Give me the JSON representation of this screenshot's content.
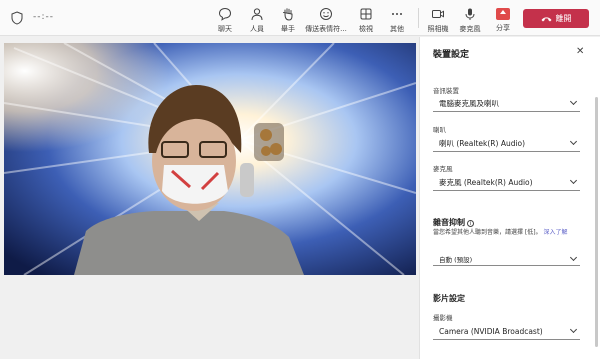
{
  "header": {
    "timer": "--:--"
  },
  "toolbar": [
    {
      "label": "聊天",
      "icon": "chat-icon"
    },
    {
      "label": "人員",
      "icon": "people-icon"
    },
    {
      "label": "舉手",
      "icon": "raise-hand-icon"
    },
    {
      "label": "傳送表情符...",
      "icon": "emoji-icon"
    },
    {
      "label": "檢視",
      "icon": "view-icon"
    },
    {
      "label": "其他",
      "icon": "more-icon"
    },
    {
      "label": "照相機",
      "icon": "camera-icon"
    },
    {
      "label": "麥克風",
      "icon": "mic-icon"
    },
    {
      "label": "分享",
      "icon": "share-icon"
    }
  ],
  "leave_label": "離開",
  "panel": {
    "title": "裝置設定",
    "audio_device_label": "音訊裝置",
    "audio_device_value": "電腦麥克風及喇叭",
    "speaker_label": "喇叭",
    "speaker_value": "喇叭 (Realtek(R) Audio)",
    "mic_label": "麥克風",
    "mic_value": "麥克風 (Realtek(R) Audio)",
    "noise_title": "雜音抑制",
    "noise_desc": "當您希望其他人聽到音樂，請選擇 [低]。",
    "noise_link": "深入了解",
    "noise_value": "自動 (預設)",
    "video_title": "影片設定",
    "camera_label": "攝影機",
    "camera_value": "Camera (NVIDIA Broadcast)"
  },
  "colors": {
    "leave": "#c4314b",
    "link": "#5b5fc7",
    "share": "#e04a4a"
  }
}
